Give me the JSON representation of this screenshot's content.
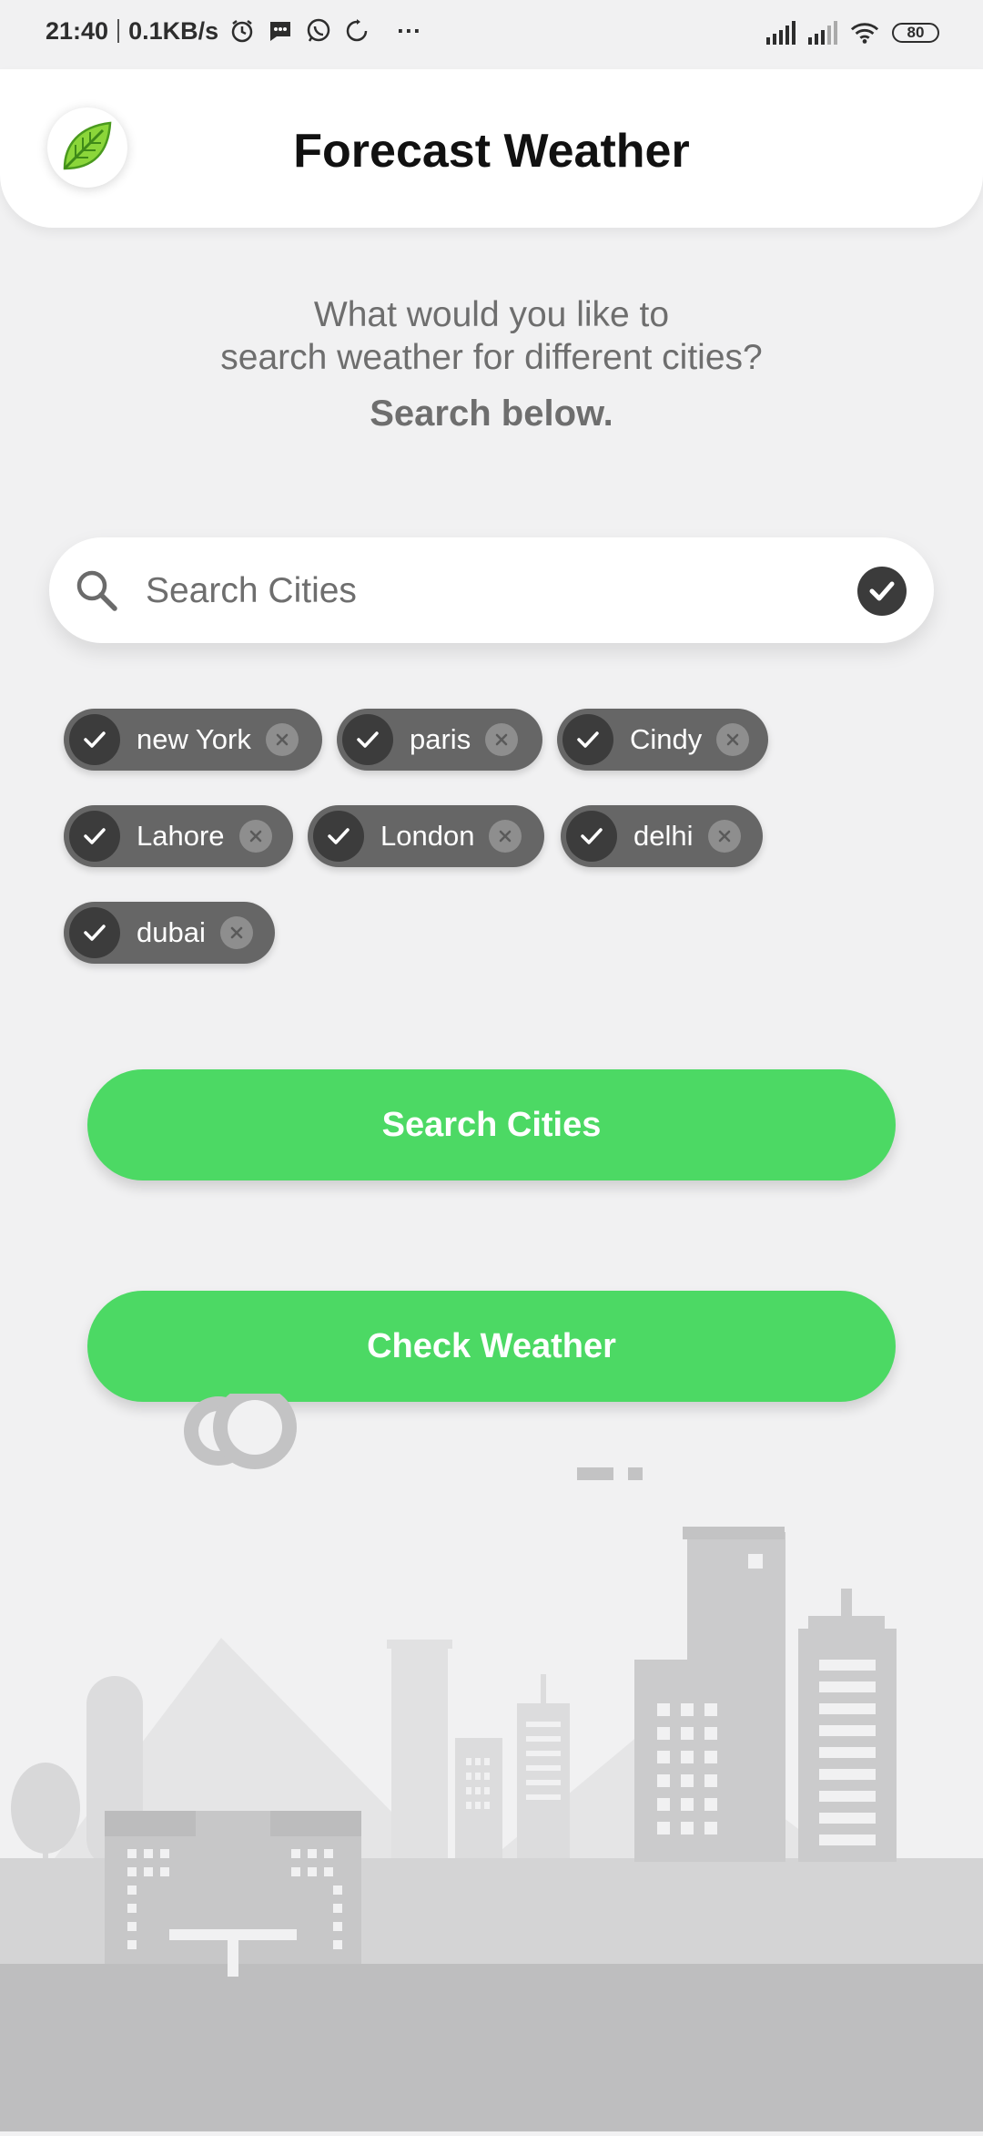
{
  "status_bar": {
    "time": "21:40",
    "speed": "0.1KB/s",
    "more": "···",
    "battery": "80",
    "icons": [
      "alarm-icon",
      "message-icon",
      "whatsapp-icon",
      "sync-icon",
      "signal-icon",
      "signal-icon",
      "wifi-icon",
      "battery-icon"
    ]
  },
  "header": {
    "logo_icon": "leaf-icon",
    "title": "Forecast Weather"
  },
  "intro": {
    "line1": "What would you like to",
    "line2": "search weather for different cities?",
    "emphasis": "Search below."
  },
  "search": {
    "placeholder": "Search Cities",
    "value": "",
    "icons": [
      "search-icon",
      "check-icon"
    ]
  },
  "chips": [
    {
      "label": "new York"
    },
    {
      "label": "paris"
    },
    {
      "label": "Cindy"
    },
    {
      "label": "Lahore"
    },
    {
      "label": "London"
    },
    {
      "label": "delhi"
    },
    {
      "label": "dubai"
    }
  ],
  "buttons": {
    "search_cities": "Search Cities",
    "check_weather": "Check Weather"
  },
  "colors": {
    "accent": "#4cd964",
    "chip": "#666666",
    "background": "#f1f1f2"
  }
}
